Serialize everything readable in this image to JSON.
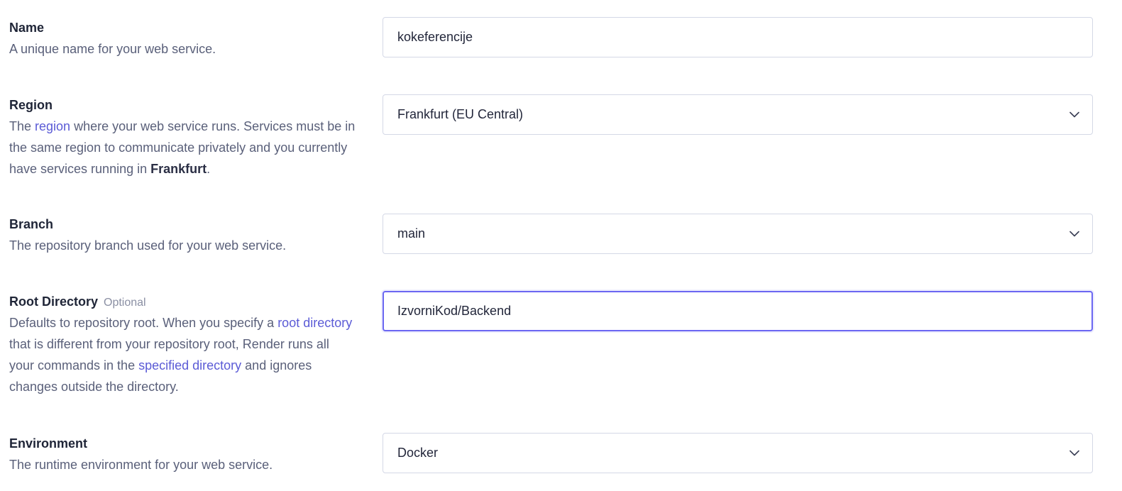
{
  "fields": {
    "name": {
      "title": "Name",
      "description": "A unique name for your web service.",
      "value": "kokeferencije"
    },
    "region": {
      "title": "Region",
      "desc_prefix": "The ",
      "desc_link": "region",
      "desc_middle": " where your web service runs. Services must be in the same region to communicate privately and you currently have services running in ",
      "desc_bold": "Frankfurt",
      "desc_suffix": ".",
      "value": "Frankfurt (EU Central)"
    },
    "branch": {
      "title": "Branch",
      "description": "The repository branch used for your web service.",
      "value": "main"
    },
    "root_directory": {
      "title": "Root Directory",
      "optional_label": "Optional",
      "desc_prefix": "Defaults to repository root. When you specify a ",
      "desc_link1": "root directory",
      "desc_middle": " that is different from your repository root, Render runs all your commands in the ",
      "desc_link2": "specified directory",
      "desc_suffix": " and ignores changes outside the directory.",
      "value": "IzvorniKod/Backend"
    },
    "environment": {
      "title": "Environment",
      "description": "The runtime environment for your web service.",
      "value": "Docker"
    }
  },
  "icons": {
    "dropdown": "chevron-down-icon"
  },
  "colors": {
    "link": "#5b5bd6",
    "focus_border": "#6b67f2",
    "input_border": "#d4d8e6"
  }
}
